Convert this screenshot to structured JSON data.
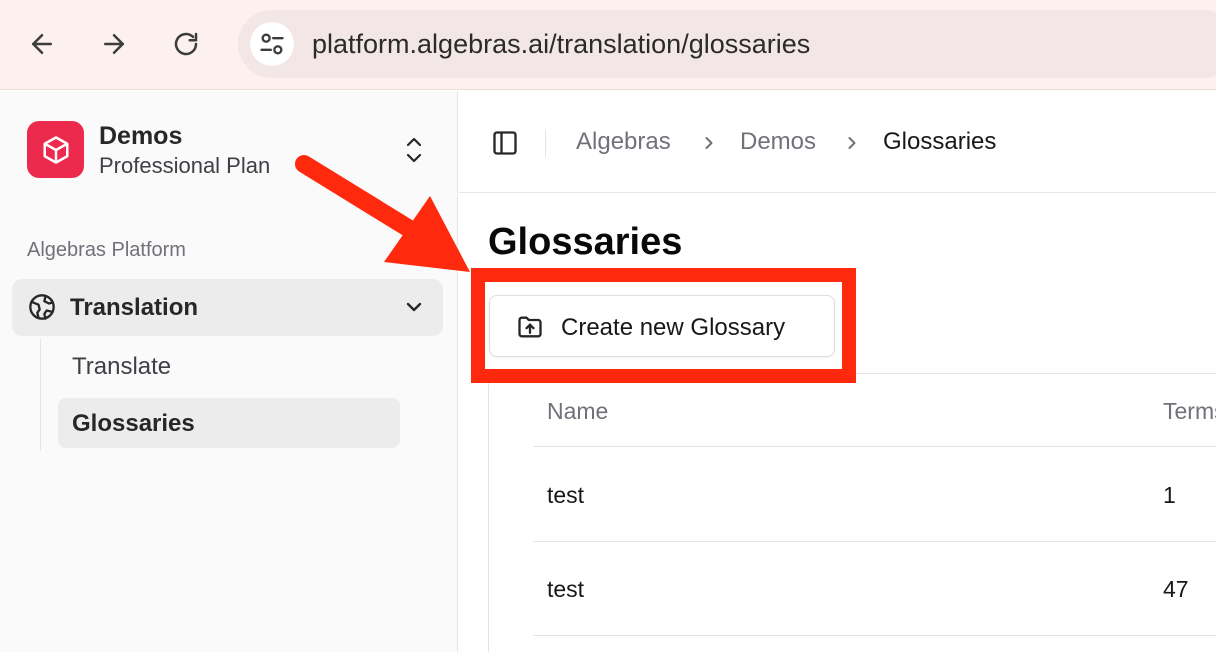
{
  "browser": {
    "url": "platform.algebras.ai/translation/glossaries"
  },
  "sidebar": {
    "org_name": "Demos",
    "org_plan": "Professional Plan",
    "section_label": "Algebras Platform",
    "nav": {
      "translation": "Translation",
      "translate": "Translate",
      "glossaries": "Glossaries"
    }
  },
  "header": {
    "breadcrumb": [
      "Algebras",
      "Demos",
      "Glossaries"
    ]
  },
  "main": {
    "title": "Glossaries",
    "create_button": "Create new Glossary",
    "table": {
      "columns": [
        "Name",
        "Terms"
      ],
      "rows": [
        {
          "name": "test",
          "terms": "1"
        },
        {
          "name": "test",
          "terms": "47"
        }
      ]
    }
  },
  "colors": {
    "brand": "#ec2a4e",
    "annotation": "#ff2a0e"
  }
}
